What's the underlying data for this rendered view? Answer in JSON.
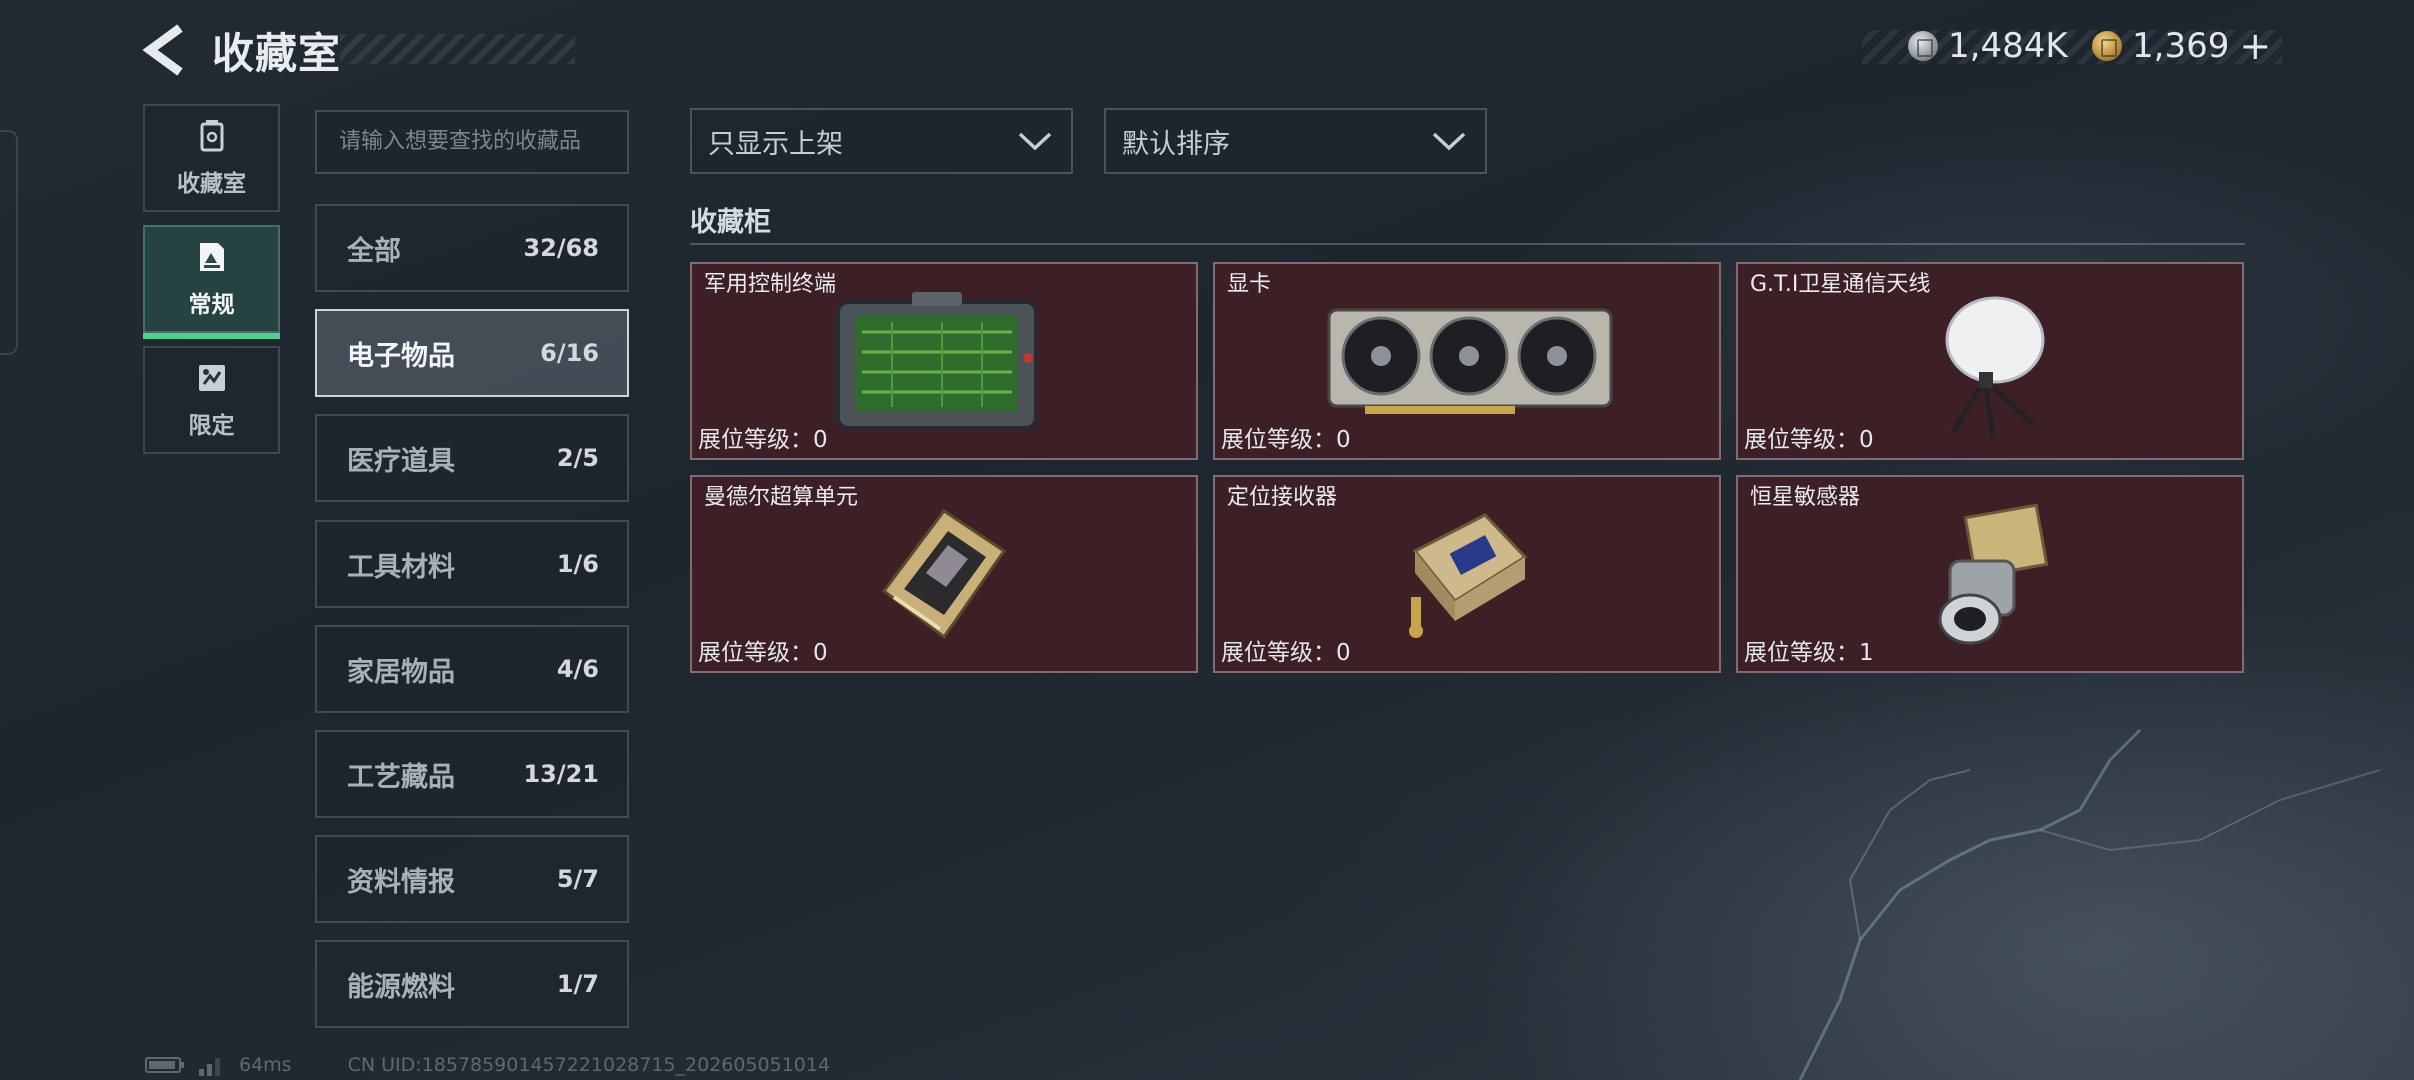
{
  "header": {
    "title": "收藏室",
    "back_icon": "back-arrow-icon",
    "currency_silver": "1,484K",
    "currency_gold": "1,369",
    "add_label": "+"
  },
  "nav": {
    "items": [
      {
        "label": "收藏室",
        "icon": "trash-icon"
      },
      {
        "label": "常规",
        "icon": "image-card-icon",
        "active": true
      },
      {
        "label": "限定",
        "icon": "special-card-icon"
      }
    ]
  },
  "search": {
    "placeholder": "请输入想要查找的收藏品"
  },
  "categories": [
    {
      "name": "全部",
      "count": "32/68"
    },
    {
      "name": "电子物品",
      "count": "6/16",
      "active": true
    },
    {
      "name": "医疗道具",
      "count": "2/5"
    },
    {
      "name": "工具材料",
      "count": "1/6"
    },
    {
      "name": "家居物品",
      "count": "4/6"
    },
    {
      "name": "工艺藏品",
      "count": "13/21"
    },
    {
      "name": "资料情报",
      "count": "5/7"
    },
    {
      "name": "能源燃料",
      "count": "1/7"
    }
  ],
  "filters": {
    "filter_label": "只显示上架",
    "sort_label": "默认排序"
  },
  "cabinet": {
    "title": "收藏柜",
    "items": [
      {
        "name": "军用控制终端",
        "level": "展位等级：0",
        "icon": "military-terminal-icon"
      },
      {
        "name": "显卡",
        "level": "展位等级：0",
        "icon": "graphics-card-icon"
      },
      {
        "name": "G.T.I卫星通信天线",
        "level": "展位等级：0",
        "icon": "satellite-dish-icon"
      },
      {
        "name": "曼德尔超算单元",
        "level": "展位等级：0",
        "icon": "supercomputer-chip-icon"
      },
      {
        "name": "定位接收器",
        "level": "展位等级：0",
        "icon": "gps-receiver-icon"
      },
      {
        "name": "恒星敏感器",
        "level": "展位等级：1",
        "icon": "star-sensor-icon"
      }
    ]
  },
  "footer": {
    "ping": "64ms",
    "uid": "CN UID:18578590145722102871​5_202605051014"
  },
  "colors": {
    "accent_green": "#4fd08a",
    "card_bg": "#3c2026"
  }
}
